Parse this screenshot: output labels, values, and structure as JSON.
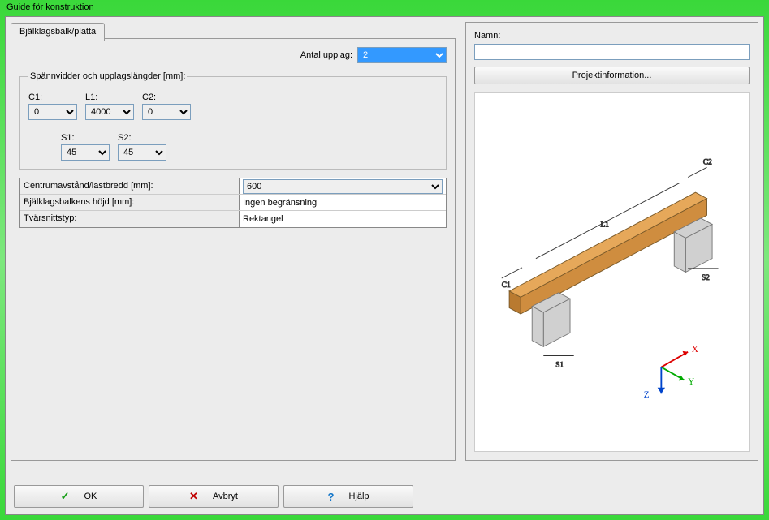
{
  "window": {
    "title": "Guide för konstruktion"
  },
  "tab": {
    "label": "Bjälklagsbalk/platta"
  },
  "supports": {
    "label": "Antal upplag:",
    "value": "2"
  },
  "spans": {
    "legend": "Spännvidder och upplagslängder [mm]:",
    "C1": {
      "label": "C1:",
      "value": "0"
    },
    "L1": {
      "label": "L1:",
      "value": "4000"
    },
    "C2": {
      "label": "C2:",
      "value": "0"
    },
    "S1": {
      "label": "S1:",
      "value": "45"
    },
    "S2": {
      "label": "S2:",
      "value": "45"
    }
  },
  "props": {
    "centrum": {
      "label": "Centrumavstånd/lastbredd [mm]:",
      "value": "600"
    },
    "hojd": {
      "label": "Bjälklagsbalkens höjd [mm]:",
      "value": "Ingen begränsning"
    },
    "tvars": {
      "label": "Tvärsnittstyp:",
      "value": "Rektangel"
    }
  },
  "right": {
    "name_label": "Namn:",
    "name_value": "",
    "proj_button": "Projektinformation..."
  },
  "diagram_labels": {
    "C1": "C1",
    "L1": "L1",
    "C2": "C2",
    "S1": "S1",
    "S2": "S2",
    "X": "X",
    "Y": "Y",
    "Z": "Z"
  },
  "buttons": {
    "ok": "OK",
    "cancel": "Avbryt",
    "help": "Hjälp"
  }
}
